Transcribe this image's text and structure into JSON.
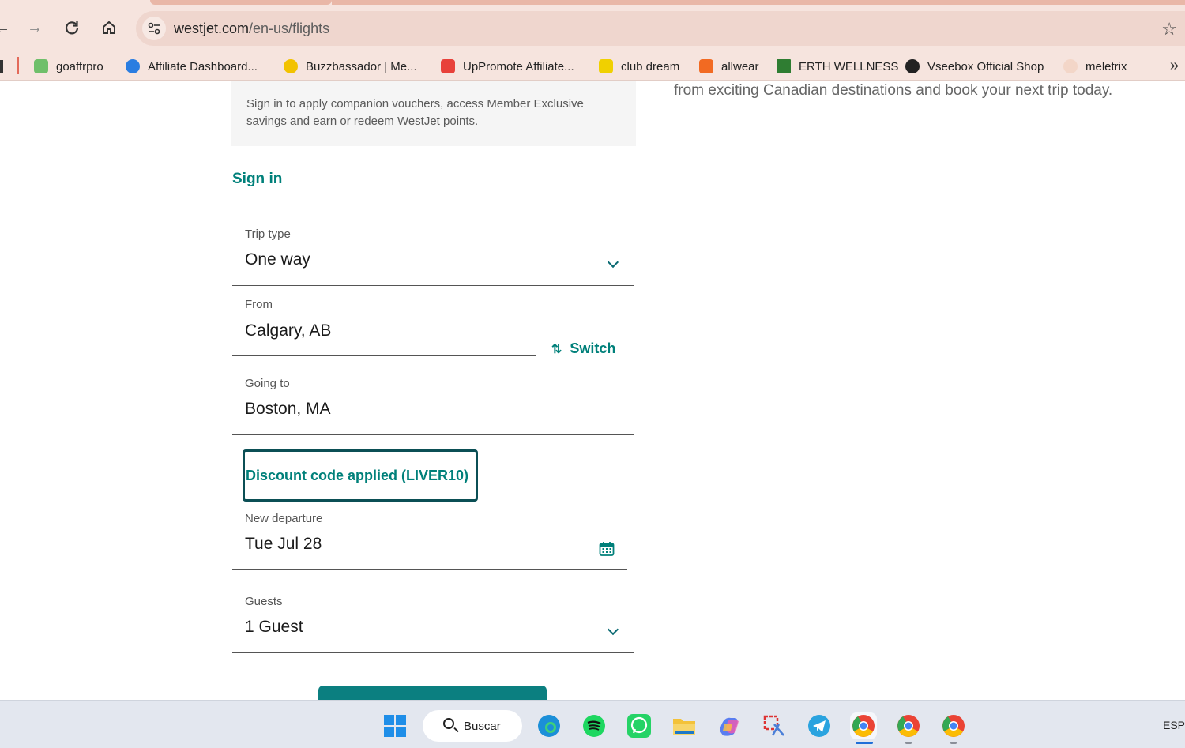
{
  "browser": {
    "url_host": "westjet.com",
    "url_path": "/en-us/flights",
    "nav": {
      "back": "back",
      "forward": "forward",
      "reload": "reload",
      "home": "home"
    }
  },
  "bookmarks": [
    {
      "label": "goaffrpro",
      "icon_color": "#6fbf6a"
    },
    {
      "label": "Affiliate Dashboard...",
      "icon_color": "#2a7de1"
    },
    {
      "label": "Buzzbassador | Me...",
      "icon_color": "#f2c200"
    },
    {
      "label": "UpPromote Affiliate...",
      "icon_color": "#e8413a"
    },
    {
      "label": "club dream",
      "icon_color": "#f0d000"
    },
    {
      "label": "allwear",
      "icon_color": "#f26a22"
    },
    {
      "label": "ERTH WELLNESS",
      "icon_color": "#2f7d32"
    },
    {
      "label": "Vseebox Official Shop",
      "icon_color": "#222222"
    },
    {
      "label": "meletrix",
      "icon_color": "#e7b9a0"
    }
  ],
  "page": {
    "promo_text": "from exciting Canadian destinations and book your next trip today.",
    "signin_info_line1": "Sign in to apply companion vouchers, access Member Exclusive",
    "signin_info_line2": "savings and earn or redeem WestJet points.",
    "signin_link": "Sign in",
    "trip_type": {
      "label": "Trip type",
      "value": "One way"
    },
    "from": {
      "label": "From",
      "value": "Calgary, AB"
    },
    "switch_label": "Switch",
    "going_to": {
      "label": "Going to",
      "value": "Boston, MA"
    },
    "discount_label": "Discount code applied (LIVER10)",
    "new_departure": {
      "label": "New departure",
      "value": "Tue Jul 28"
    },
    "guests": {
      "label": "Guests",
      "value": "1 Guest"
    }
  },
  "taskbar": {
    "search_label": "Buscar",
    "language": "ESP",
    "apps": [
      "windows-start",
      "edge",
      "spotify",
      "whatsapp",
      "file-explorer",
      "copilot",
      "snipping-tool",
      "telegram",
      "chrome",
      "chrome",
      "chrome"
    ]
  },
  "colors": {
    "accent": "#00807a",
    "chrome_bg": "#f6e4de",
    "discount_border": "#0b4f55",
    "button": "#0b7f80"
  }
}
